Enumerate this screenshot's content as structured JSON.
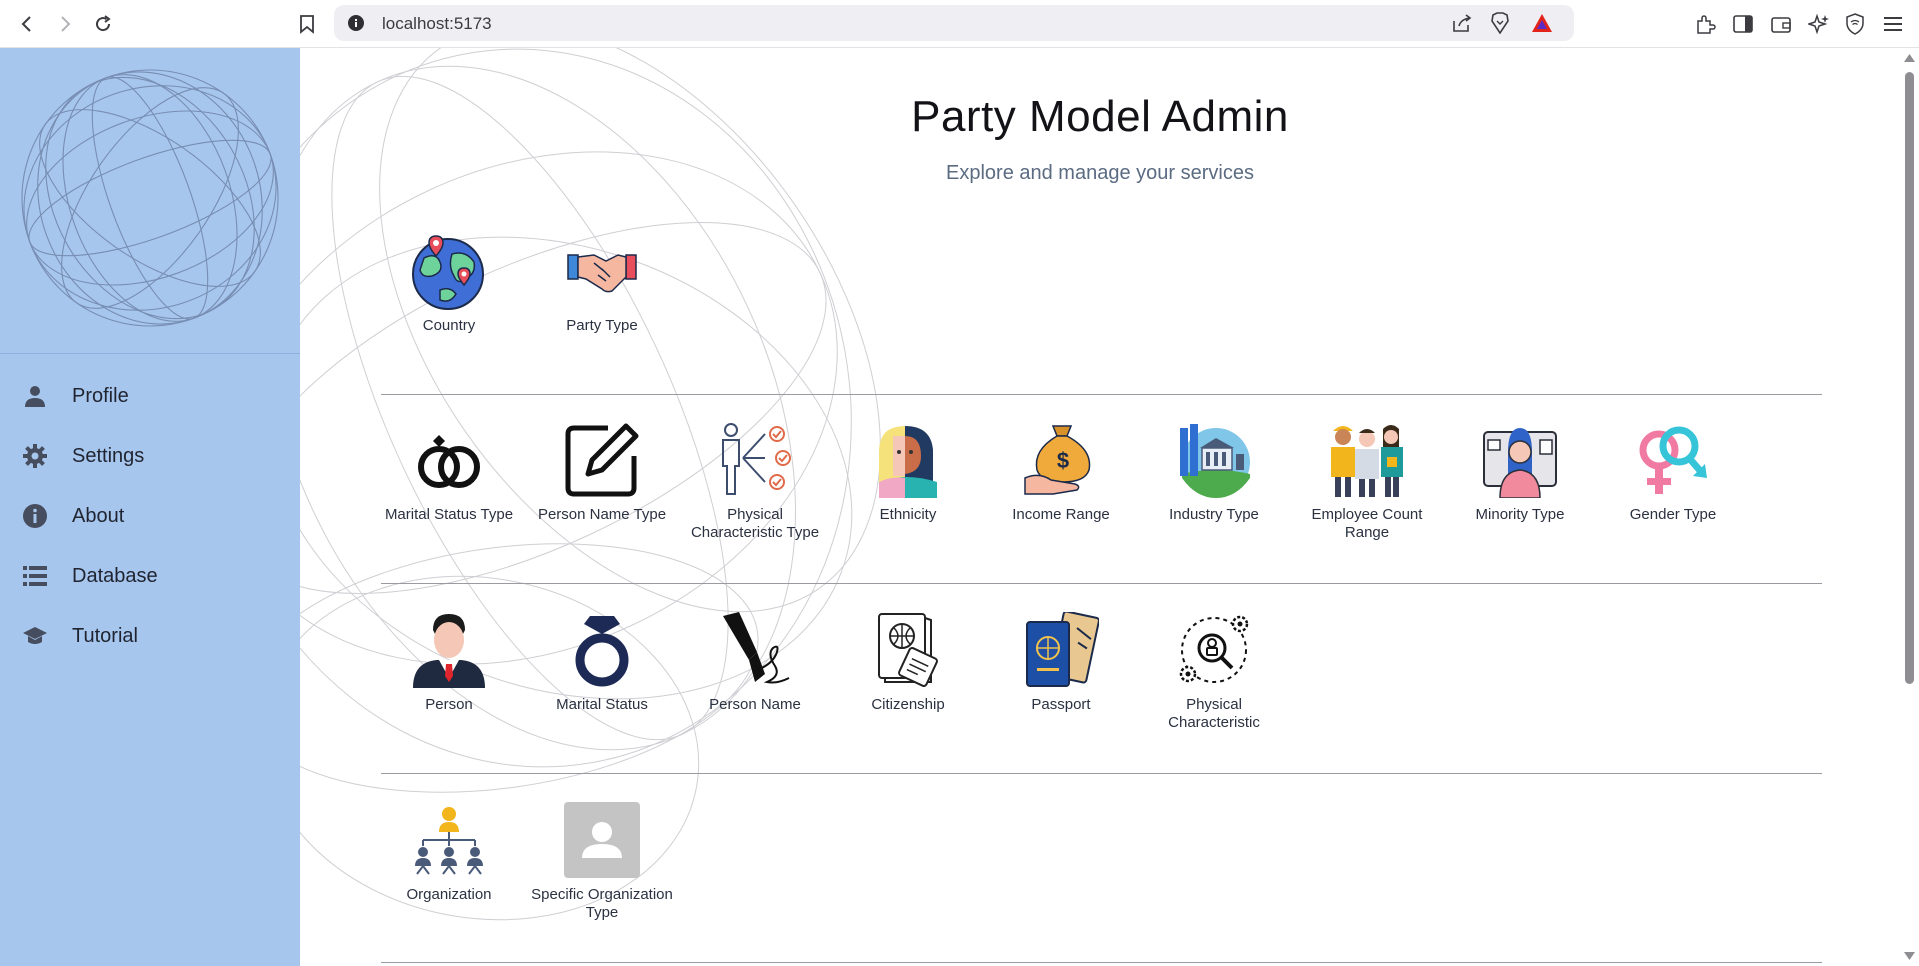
{
  "browser": {
    "url": "localhost:5173"
  },
  "sidebar": {
    "items": [
      {
        "label": "Profile",
        "icon": "person-icon"
      },
      {
        "label": "Settings",
        "icon": "gear-icon"
      },
      {
        "label": "About",
        "icon": "info-icon"
      },
      {
        "label": "Database",
        "icon": "database-icon"
      },
      {
        "label": "Tutorial",
        "icon": "graduation-cap-icon"
      }
    ]
  },
  "header": {
    "title": "Party Model Admin",
    "subtitle": "Explore and manage your services"
  },
  "sections": [
    {
      "tiles": [
        {
          "label": "Country",
          "icon": "globe-pins-icon"
        },
        {
          "label": "Party Type",
          "icon": "handshake-icon"
        }
      ]
    },
    {
      "tiles": [
        {
          "label": "Marital Status Type",
          "icon": "rings-icon"
        },
        {
          "label": "Person Name Type",
          "icon": "edit-pen-icon"
        },
        {
          "label": "Physical Characteristic Type",
          "icon": "person-checklist-icon"
        },
        {
          "label": "Ethnicity",
          "icon": "ethnicity-faces-icon"
        },
        {
          "label": "Income Range",
          "icon": "money-bag-hand-icon"
        },
        {
          "label": "Industry Type",
          "icon": "industry-building-icon"
        },
        {
          "label": "Employee Count Range",
          "icon": "employees-group-icon"
        },
        {
          "label": "Minority Type",
          "icon": "woman-badge-icon"
        },
        {
          "label": "Gender Type",
          "icon": "gender-symbols-icon"
        }
      ]
    },
    {
      "tiles": [
        {
          "label": "Person",
          "icon": "businessman-icon"
        },
        {
          "label": "Marital Status",
          "icon": "diamond-ring-icon"
        },
        {
          "label": "Person Name",
          "icon": "fountain-pen-icon"
        },
        {
          "label": "Citizenship",
          "icon": "citizenship-document-icon"
        },
        {
          "label": "Passport",
          "icon": "passport-icon"
        },
        {
          "label": "Physical Characteristic",
          "icon": "search-person-gears-icon"
        }
      ]
    },
    {
      "tiles": [
        {
          "label": "Organization",
          "icon": "org-chart-icon"
        },
        {
          "label": "Specific Organization Type",
          "icon": "placeholder-avatar-icon"
        }
      ]
    }
  ]
}
